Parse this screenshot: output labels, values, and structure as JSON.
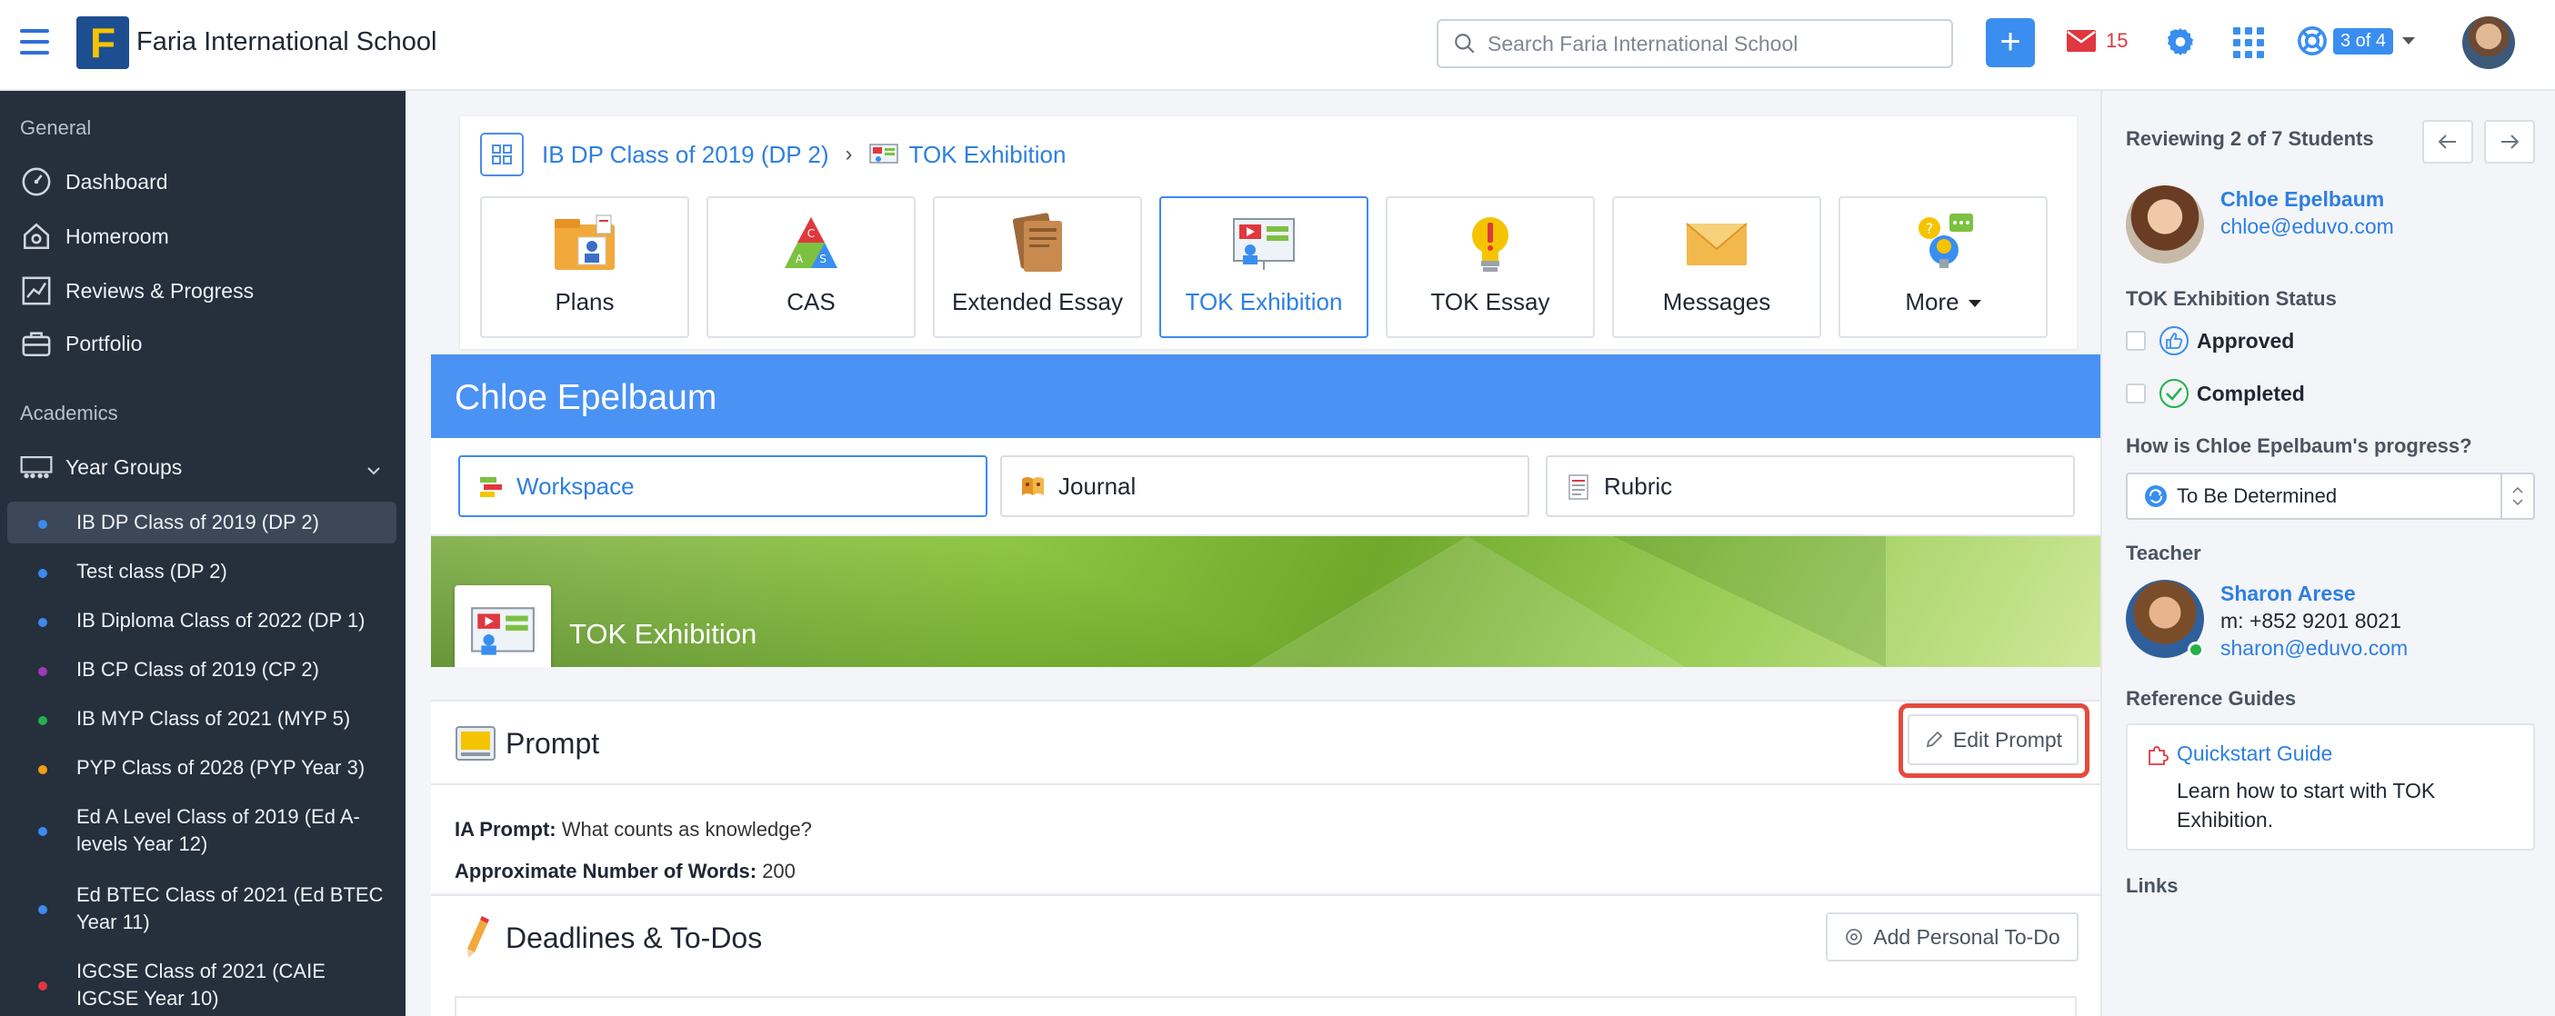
{
  "header": {
    "school_name": "Faria International School",
    "logo_letter": "F",
    "search_placeholder": "Search Faria International School",
    "add_label": "+",
    "mail_count": "15",
    "help_badge": "3 of 4"
  },
  "sidebar": {
    "general_label": "General",
    "general_items": [
      {
        "label": "Dashboard",
        "icon": "dashboard-icon"
      },
      {
        "label": "Homeroom",
        "icon": "homeroom-icon"
      },
      {
        "label": "Reviews & Progress",
        "icon": "chart-icon"
      },
      {
        "label": "Portfolio",
        "icon": "briefcase-icon"
      }
    ],
    "academics_label": "Academics",
    "year_groups_label": "Year Groups",
    "classes": [
      {
        "label": "IB DP Class of 2019 (DP 2)",
        "color": "#3d8af0",
        "active": true
      },
      {
        "label": "Test class (DP 2)",
        "color": "#3d8af0"
      },
      {
        "label": "IB Diploma Class of 2022 (DP 1)",
        "color": "#3d8af0"
      },
      {
        "label": "IB CP Class of 2019 (CP 2)",
        "color": "#9b3bb5"
      },
      {
        "label": "IB MYP Class of 2021 (MYP 5)",
        "color": "#22b14c"
      },
      {
        "label": "PYP Class of 2028 (PYP Year 3)",
        "color": "#f39c12"
      },
      {
        "label": "Ed A Level Class of 2019 (Ed A-levels Year 12)",
        "color": "#3d8af0"
      },
      {
        "label": "Ed BTEC Class of 2021 (Ed BTEC Year 11)",
        "color": "#3d8af0"
      },
      {
        "label": "IGCSE Class of 2021 (CAIE IGCSE Year 10)",
        "color": "#e0383e"
      }
    ]
  },
  "breadcrumb": {
    "class_link": "IB DP Class of 2019 (DP 2)",
    "current": "TOK Exhibition"
  },
  "tiles": [
    {
      "label": "Plans",
      "icon": "plans-icon"
    },
    {
      "label": "CAS",
      "icon": "cas-icon"
    },
    {
      "label": "Extended Essay",
      "icon": "extended-essay-icon"
    },
    {
      "label": "TOK Exhibition",
      "icon": "tok-exhibition-icon",
      "active": true
    },
    {
      "label": "TOK Essay",
      "icon": "lightbulb-icon"
    },
    {
      "label": "Messages",
      "icon": "envelope-icon"
    },
    {
      "label": "More",
      "icon": "more-icon"
    }
  ],
  "student": {
    "name": "Chloe Epelbaum"
  },
  "subtabs": [
    {
      "label": "Workspace",
      "active": true
    },
    {
      "label": "Journal"
    },
    {
      "label": "Rubric"
    }
  ],
  "banner": {
    "title": "TOK Exhibition"
  },
  "prompt": {
    "title": "Prompt",
    "edit_label": "Edit Prompt",
    "ia_label": "IA Prompt:",
    "ia_value": "What counts as knowledge?",
    "words_label": "Approximate Number of Words:",
    "words_value": "200"
  },
  "deadlines": {
    "title": "Deadlines & To-Dos",
    "add_label": "Add Personal To-Do"
  },
  "right": {
    "reviewing": "Reviewing 2 of 7 Students",
    "student_name": "Chloe Epelbaum",
    "student_email": "chloe@eduvo.com",
    "status_label": "TOK Exhibition Status",
    "approved": "Approved",
    "completed": "Completed",
    "progress_label": "How is Chloe Epelbaum's progress?",
    "progress_value": "To Be Determined",
    "teacher_label": "Teacher",
    "teacher_name": "Sharon Arese",
    "teacher_phone": "m: +852 9201 8021",
    "teacher_email": "sharon@eduvo.com",
    "guides_label": "Reference Guides",
    "guide_link": "Quickstart Guide",
    "guide_desc": "Learn how to start with TOK Exhibition.",
    "links_label": "Links"
  },
  "colors": {
    "accent": "#3a8ef0",
    "sidebar": "#262f3c",
    "highlight": "#e44b3e"
  }
}
